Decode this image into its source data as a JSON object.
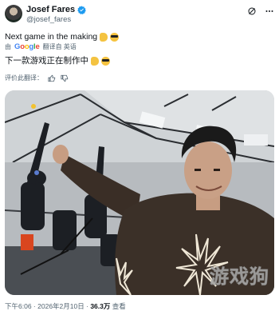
{
  "header": {
    "display_name": "Josef Fares",
    "handle": "@josef_fares",
    "icons": [
      "verified-badge-icon",
      "grok-icon",
      "more-icon"
    ]
  },
  "post": {
    "text": "Next game in the making",
    "emojis": [
      "thumbs-up",
      "smiling-face-with-sunglasses"
    ]
  },
  "translation": {
    "via_label": "由",
    "google_letters": [
      "G",
      "o",
      "o",
      "g",
      "l",
      "e"
    ],
    "translated_from": "翻译自 英语",
    "text": "下一款游戏正在制作中"
  },
  "rating": {
    "label": "评价此翻译："
  },
  "footer": {
    "time": "下午6:06",
    "separator": "·",
    "date": "2026年2月10日",
    "views_value": "36.3万",
    "views_label": "查看"
  },
  "watermark": "游戏狗",
  "colors": {
    "text": "#0f1419",
    "secondary": "#536471",
    "verified": "#1d9bf0"
  }
}
